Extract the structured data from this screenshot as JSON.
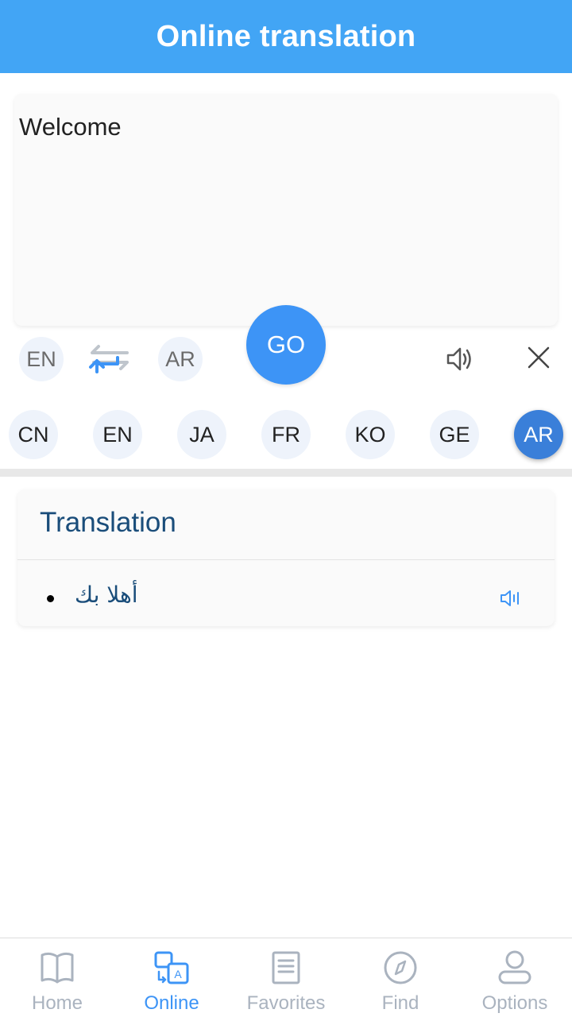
{
  "header": {
    "title": "Online translation"
  },
  "input": {
    "text": "Welcome"
  },
  "controls": {
    "source_lang": "EN",
    "target_lang": "AR",
    "go_label": "GO"
  },
  "languages": [
    {
      "code": "CN",
      "selected": false
    },
    {
      "code": "EN",
      "selected": false
    },
    {
      "code": "JA",
      "selected": false
    },
    {
      "code": "FR",
      "selected": false
    },
    {
      "code": "KO",
      "selected": false
    },
    {
      "code": "GE",
      "selected": false
    },
    {
      "code": "AR",
      "selected": true
    }
  ],
  "result": {
    "title": "Translation",
    "items": [
      {
        "text": "أهلا بك"
      }
    ]
  },
  "bottom_nav": {
    "items": [
      {
        "label": "Home",
        "icon": "book-icon",
        "active": false
      },
      {
        "label": "Online",
        "icon": "translate-icon",
        "active": true
      },
      {
        "label": "Favorites",
        "icon": "document-icon",
        "active": false
      },
      {
        "label": "Find",
        "icon": "compass-icon",
        "active": false
      },
      {
        "label": "Options",
        "icon": "user-icon",
        "active": false
      }
    ]
  },
  "colors": {
    "header": "#42a5f5",
    "accent": "#3d94f6",
    "selected_chip": "#3a7fd9",
    "result_text": "#1a4d7a",
    "nav_inactive": "#aab3bf"
  }
}
